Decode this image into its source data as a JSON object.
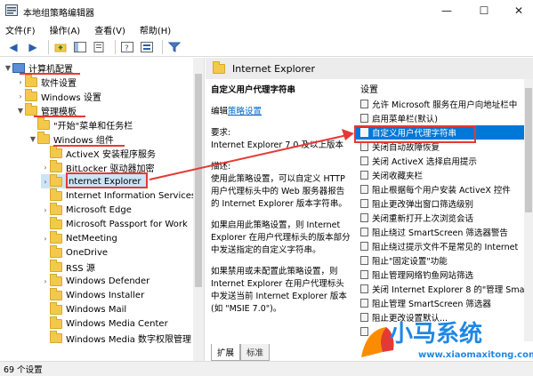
{
  "window": {
    "title": "本地组策略编辑器",
    "min_glyph": "—",
    "max_glyph": "☐",
    "close_glyph": "✕"
  },
  "menu": [
    "文件(F)",
    "操作(A)",
    "查看(V)",
    "帮助(H)"
  ],
  "tree": {
    "items": [
      {
        "label": "计算机配置",
        "expanded": true
      },
      {
        "label": "软件设置"
      },
      {
        "label": "Windows 设置"
      },
      {
        "label": "管理模板",
        "expanded": true
      },
      {
        "label": "\"开始\"菜单和任务栏"
      },
      {
        "label": "Windows 组件",
        "expanded": true
      },
      {
        "label": "ActiveX 安装程序服务"
      },
      {
        "label": "BitLocker 驱动器加密"
      },
      {
        "label": "Internet Explorer",
        "selected": true
      },
      {
        "label": "Internet Information Services"
      },
      {
        "label": "Microsoft Edge"
      },
      {
        "label": "Microsoft Passport for Work"
      },
      {
        "label": "NetMeeting"
      },
      {
        "label": "OneDrive"
      },
      {
        "label": "RSS 源"
      },
      {
        "label": "Windows Defender"
      },
      {
        "label": "Windows Installer"
      },
      {
        "label": "Windows Mail"
      },
      {
        "label": "Windows Media Center"
      },
      {
        "label": "Windows Media 数字权限管理"
      }
    ]
  },
  "right": {
    "header": "Internet Explorer",
    "desc_title": "自定义用户代理字符串",
    "edit_prefix": "编辑",
    "edit_link": "策略设置",
    "req_label": "要求:",
    "req_text": "Internet Explorer 7.0 及以上版本",
    "desc_label": "描述:",
    "desc_text": "使用此策略设置，可以自定义 HTTP 用户代理标头中的 Web 服务器报告的 Internet Explorer 版本字符串。",
    "para2": "如果启用此策略设置，则 Internet Explorer 在用户代理标头的版本部分中发送指定的自定义字符串。",
    "para3": "如果禁用或未配置此策略设置，则 Internet Explorer 在用户代理标头中发送当前 Internet Explorer 版本(如 \"MSIE 7.0\")。",
    "settings_header": "设置",
    "settings": [
      {
        "label": "允许 Microsoft 服务在用户向地址栏中"
      },
      {
        "label": "启用菜单栏(默认)"
      },
      {
        "label": "自定义用户代理字符串",
        "selected": true
      },
      {
        "label": "关闭自动故障恢复"
      },
      {
        "label": "关闭 ActiveX 选择启用提示"
      },
      {
        "label": "关闭收藏夹栏"
      },
      {
        "label": "阻止根据每个用户安装 ActiveX 控件"
      },
      {
        "label": "阻止更改弹出窗口筛选级别"
      },
      {
        "label": "关闭重新打开上次浏览会话"
      },
      {
        "label": "阻止绕过 SmartScreen 筛选器警告"
      },
      {
        "label": "阻止绕过提示文件不是常见的 Internet"
      },
      {
        "label": "阻止\"固定设置\"功能"
      },
      {
        "label": "阻止管理网络钓鱼网站筛选"
      },
      {
        "label": "关闭 Internet Explorer 8 的\"管理 Sma"
      },
      {
        "label": "阻止管理 SmartScreen 筛选器"
      },
      {
        "label": "阻止更改设置默认..."
      },
      {
        "label": "..."
      }
    ],
    "tabs": [
      "扩展",
      "标准"
    ]
  },
  "status": "69 个设置",
  "watermark": {
    "name": "小马系统",
    "url": "www.xiaomaxitong.com"
  },
  "colors": {
    "selection": "#0078d7",
    "annotation_red": "#e53935",
    "link": "#0066cc",
    "watermark": "#1e88e5"
  }
}
